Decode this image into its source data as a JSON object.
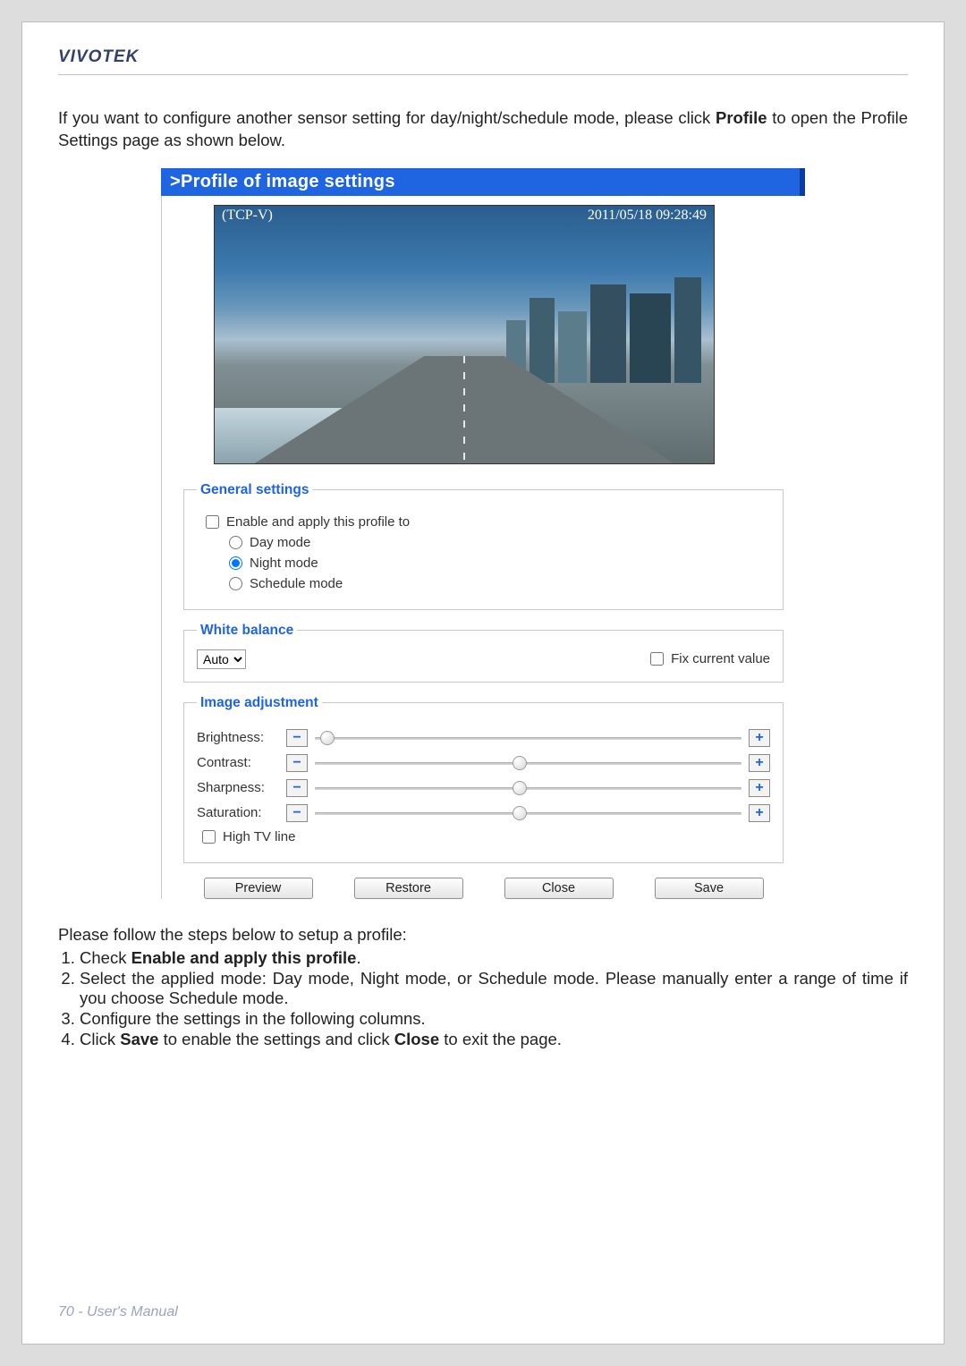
{
  "brand": "VIVOTEK",
  "intro_before": "If you want to configure another sensor setting for day/night/schedule mode, please click ",
  "intro_bold": "Profile",
  "intro_after": " to open the Profile Settings page as shown below.",
  "screenshot": {
    "titlebar": ">Profile of image settings",
    "overlay_left": "(TCP-V)",
    "overlay_right": "2011/05/18 09:28:49",
    "general": {
      "legend": "General settings",
      "enable_label": "Enable and apply this profile to",
      "mode_day": "Day mode",
      "mode_night": "Night mode",
      "mode_schedule": "Schedule mode",
      "selected_mode": "night"
    },
    "white_balance": {
      "legend": "White balance",
      "selected": "Auto",
      "fix_label": "Fix current value"
    },
    "image_adjustment": {
      "legend": "Image adjustment",
      "sliders": [
        {
          "label": "Brightness:",
          "pos_pct": 3
        },
        {
          "label": "Contrast:",
          "pos_pct": 48
        },
        {
          "label": "Sharpness:",
          "pos_pct": 48
        },
        {
          "label": "Saturation:",
          "pos_pct": 48
        }
      ],
      "high_tv_label": "High TV line"
    },
    "buttons": {
      "preview": "Preview",
      "restore": "Restore",
      "close": "Close",
      "save": "Save"
    }
  },
  "followup_intro": "Please follow the steps below to setup a profile:",
  "steps": {
    "s1_a": "Check ",
    "s1_b": "Enable and apply this profile",
    "s1_c": ".",
    "s2": "Select the applied mode: Day mode, Night mode, or Schedule mode. Please manually enter a range of time if you choose Schedule mode.",
    "s3": "Configure the settings in the following columns.",
    "s4_a": "Click ",
    "s4_b": "Save",
    "s4_c": " to enable the settings and click ",
    "s4_d": "Close",
    "s4_e": " to exit the page."
  },
  "footer": "70 - User's Manual"
}
